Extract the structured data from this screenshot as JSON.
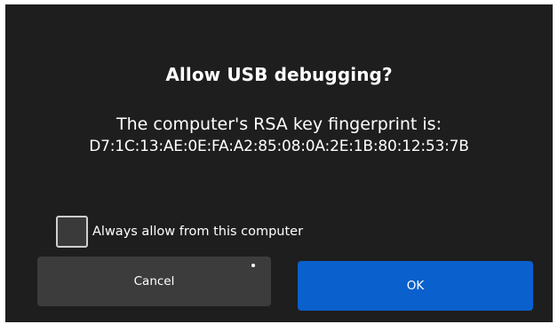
{
  "dialog": {
    "title": "Allow USB debugging?",
    "message_line1": "The computer's RSA key fingerprint is:",
    "fingerprint": "D7:1C:13:AE:0E:FA:A2:85:08:0A:2E:1B:80:12:53:7B",
    "checkbox": {
      "label": "Always allow from this computer",
      "checked": false
    },
    "buttons": {
      "cancel_label": "Cancel",
      "ok_label": "OK"
    }
  },
  "colors": {
    "dialog_bg": "#1e1e1e",
    "cancel_bg": "#3c3c3c",
    "ok_bg": "#0a60cc",
    "text": "#ffffff"
  }
}
